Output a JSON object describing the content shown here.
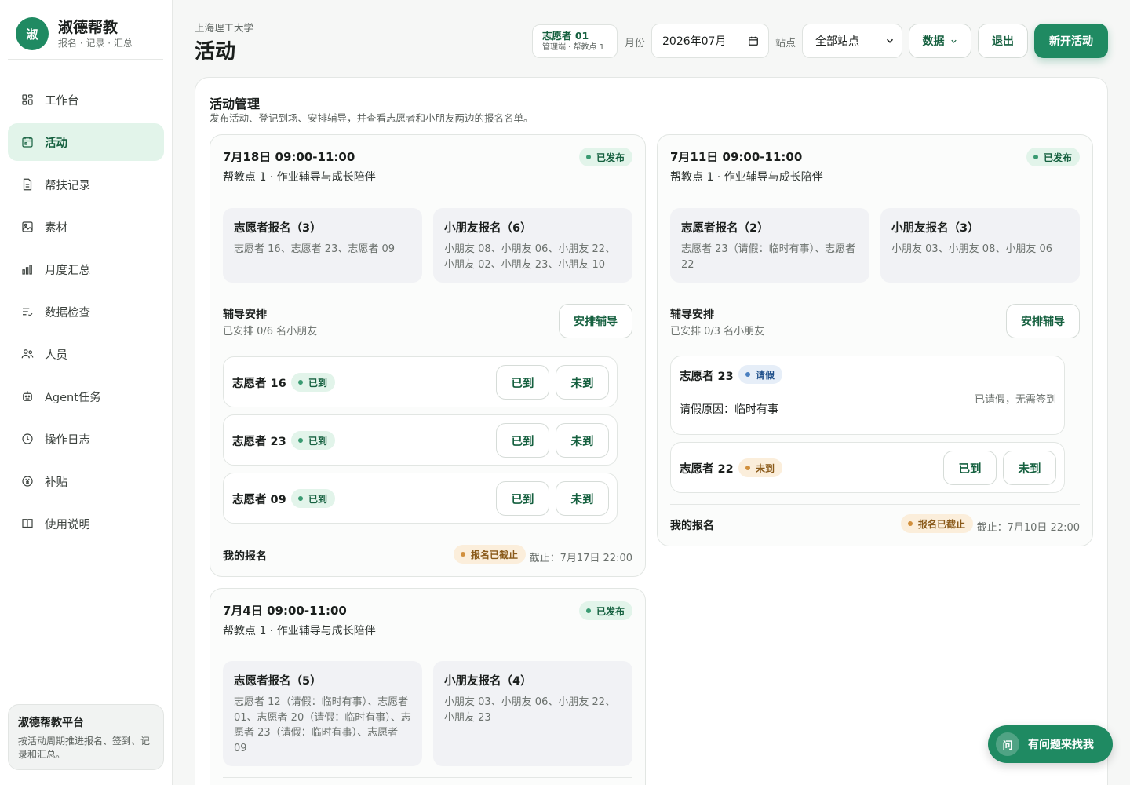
{
  "brand": {
    "logo": "淑",
    "name": "淑德帮教",
    "subtitle": "报名 · 记录 · 汇总"
  },
  "nav": [
    {
      "label": "工作台",
      "icon": "dashboard-icon"
    },
    {
      "label": "活动",
      "icon": "calendar-icon",
      "active": true
    },
    {
      "label": "帮扶记录",
      "icon": "document-icon"
    },
    {
      "label": "素材",
      "icon": "image-icon"
    },
    {
      "label": "月度汇总",
      "icon": "bar-chart-icon"
    },
    {
      "label": "数据检查",
      "icon": "checklist-icon"
    },
    {
      "label": "人员",
      "icon": "people-icon"
    },
    {
      "label": "Agent任务",
      "icon": "robot-icon"
    },
    {
      "label": "操作日志",
      "icon": "clock-icon"
    },
    {
      "label": "补贴",
      "icon": "yen-icon"
    },
    {
      "label": "使用说明",
      "icon": "book-icon"
    }
  ],
  "sidebar_card": {
    "title": "淑德帮教平台",
    "text": "按活动周期推进报名、签到、记录和汇总。"
  },
  "header": {
    "university": "上海理工大学",
    "title": "活动",
    "user_name": "志愿者 01",
    "user_role": "管理端 · 帮教点 1",
    "month_label": "月份",
    "month_value": "2026年07月",
    "site_label": "站点",
    "site_value": "全部站点",
    "data_button": "数据",
    "logout_button": "退出",
    "new_button": "新开活动"
  },
  "panel": {
    "title": "活动管理",
    "description": "发布活动、登记到场、安排辅导，并查看志愿者和小朋友两边的报名名单。"
  },
  "common": {
    "published": "已发布",
    "arrange_title": "辅导安排",
    "arrange_button": "安排辅导",
    "arrived_badge": "已到",
    "btn_arrived": "已到",
    "btn_absent": "未到",
    "leave_badge": "请假",
    "absent_badge": "未到",
    "my_signup": "我的报名",
    "signup_closed": "报名已截止"
  },
  "events": [
    {
      "date": "7月18日 09:00-11:00",
      "site": "帮教点 1 · 作业辅导与成长陪伴",
      "volunteers_title": "志愿者报名（3）",
      "volunteers": "志愿者 16、志愿者 23、志愿者 09",
      "kids_title": "小朋友报名（6）",
      "kids": "小朋友 08、小朋友 06、小朋友 22、小朋友 02、小朋友 23、小朋友 10",
      "arrange_status": "已安排 0/6 名小朋友",
      "rows": [
        {
          "name": "志愿者 16"
        },
        {
          "name": "志愿者 23"
        },
        {
          "name": "志愿者 09"
        }
      ],
      "deadline": "截止：7月17日 22:00"
    },
    {
      "date": "7月11日 09:00-11:00",
      "site": "帮教点 1 · 作业辅导与成长陪伴",
      "volunteers_title": "志愿者报名（2）",
      "volunteers": "志愿者 23（请假：临时有事）、志愿者 22",
      "kids_title": "小朋友报名（3）",
      "kids": "小朋友 03、小朋友 08、小朋友 06",
      "arrange_status": "已安排 0/3 名小朋友",
      "leave_row": {
        "name": "志愿者 23",
        "note": "已请假，无需签到",
        "reason": "请假原因：临时有事"
      },
      "absent_row": {
        "name": "志愿者 22"
      },
      "deadline": "截止：7月10日 22:00"
    },
    {
      "date": "7月4日 09:00-11:00",
      "site": "帮教点 1 · 作业辅导与成长陪伴",
      "volunteers_title": "志愿者报名（5）",
      "volunteers": "志愿者 12（请假：临时有事）、志愿者 01、志愿者 20（请假：临时有事）、志愿者 23（请假：临时有事）、志愿者 09",
      "kids_title": "小朋友报名（4）",
      "kids": "小朋友 03、小朋友 06、小朋友 22、小朋友 23"
    }
  ],
  "help": {
    "icon": "问",
    "label": "有问题来找我"
  },
  "colors": {
    "accent": "#1f8a62",
    "accent_light": "#e2f4ea",
    "warning": "#fbeedb",
    "info": "#e6eef8"
  }
}
